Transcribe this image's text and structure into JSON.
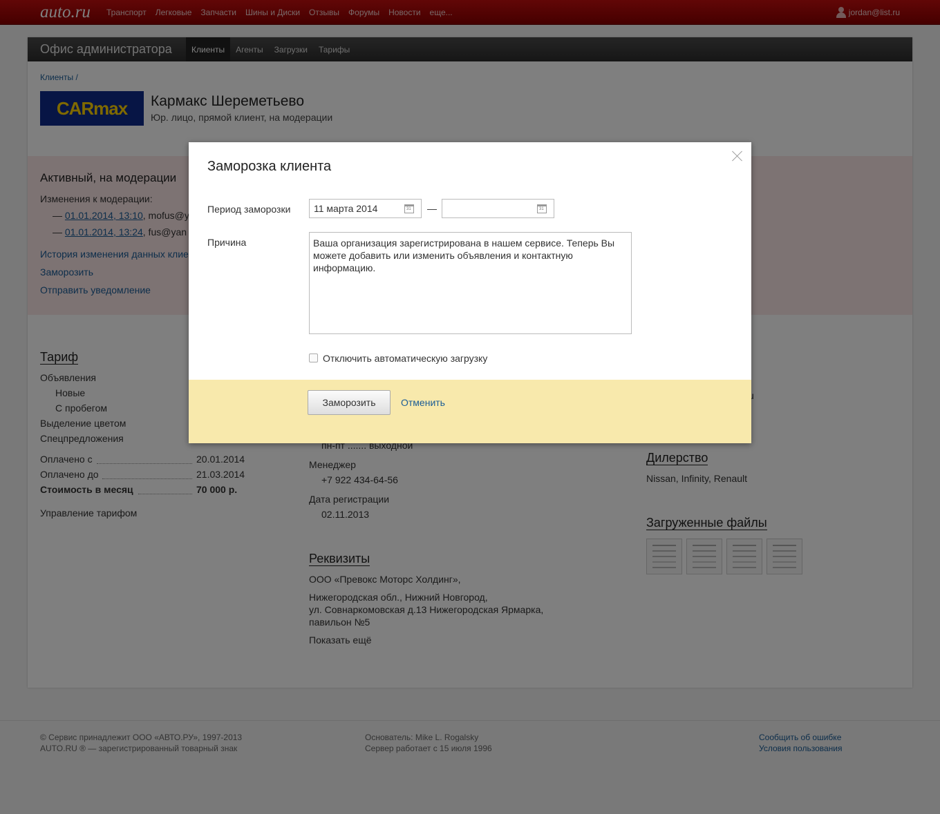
{
  "topbar": {
    "logo": "auto.ru",
    "nav": [
      "Транспорт",
      "Легковые",
      "Запчасти",
      "Шины и Диски",
      "Отзывы",
      "Форумы",
      "Новости",
      "еще..."
    ],
    "user": "jordan@list.ru"
  },
  "admin": {
    "title": "Офис администратора",
    "tabs": [
      "Клиенты",
      "Агенты",
      "Загрузки",
      "Тарифы"
    ]
  },
  "breadcrumb": "Клиенты /",
  "client": {
    "logo_text": "CARmax",
    "name": "Кармакс Шереметьево",
    "subtitle": "Юр. лицо, прямой клиент, на модерации"
  },
  "status": {
    "title": "Активный, на модерации",
    "changes_label": "Изменения к модерации:",
    "changes": [
      {
        "date": "01.01.2014, 13:10",
        "user": ", mofus@y"
      },
      {
        "date": "01.01.2014, 13:24",
        "user": ", fus@yan"
      }
    ],
    "links": [
      "История изменения данных клие",
      "Заморозить",
      "Отправить уведомление"
    ]
  },
  "tariff": {
    "title": "Тариф",
    "ads": "Объявления",
    "new": "Новые",
    "used": "С пробегом",
    "color": "Выделение цветом",
    "special": "Спецпредложения",
    "paid_from_label": "Оплачено с",
    "paid_from": "20.01.2014",
    "paid_to_label": "Оплачено до",
    "paid_to": "21.03.2014",
    "cost_label": "Стоимость в месяц",
    "cost": "70 000 р.",
    "manage": "Управление тарифом"
  },
  "middle": {
    "schedule_partial": "пн-пт ....... выходной",
    "manager_label": "Менеджер",
    "manager_phone": "+7 922 434-64-56",
    "reg_label": "Дата регистрации",
    "reg_date": "02.11.2013",
    "requisites_title": "Реквизиты",
    "company": "ООО «Превокс Моторс Холдинг»,",
    "address1": "Нижегородская обл., Нижний Новгород,",
    "address2": "ул. Совнаркомовская д.13 Нижегородская Ярмарка,",
    "address3": "павильон №5",
    "show_more": "Показать ещё"
  },
  "right": {
    "partial": "u",
    "dealer_title": "Дилерство",
    "brands": "Nissan, Infinity, Renault",
    "files_title": "Загруженные файлы"
  },
  "footer": {
    "copyright1": "© Сервис принадлежит ООО «АВТО.РУ», 1997-2013",
    "copyright2": "AUTO.RU ® — зарегистрированный товарный знак",
    "founder": "Основатель: Mike L. Rogalsky",
    "since": "Сервер работает с 15 июля 1996",
    "report": "Сообщить об ошибке",
    "terms": "Условия пользования"
  },
  "modal": {
    "title": "Заморозка клиента",
    "period_label": "Период заморозки",
    "date_from": "11 марта 2014",
    "date_to": "",
    "dash": "—",
    "reason_label": "Причина",
    "reason_text": "Ваша организация зарегистрирована в нашем сервисе. Теперь Вы можете добавить или изменить объявления и контактную информацию.",
    "checkbox_label": "Отключить автоматическую загрузку",
    "checkbox_checked": false,
    "freeze_button": "Заморозить",
    "cancel_link": "Отменить"
  }
}
